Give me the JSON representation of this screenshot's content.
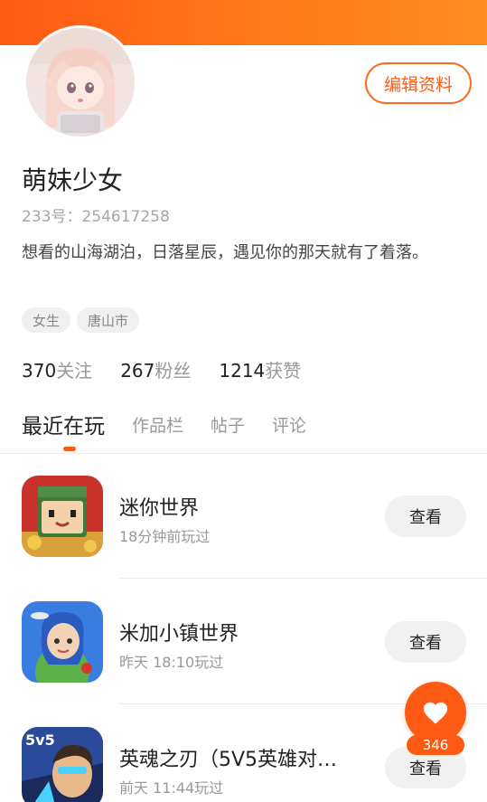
{
  "profile": {
    "nickname": "萌妹少女",
    "uid_text": "233号：254617258",
    "bio": "想看的山海湖泊，日落星辰，遇见你的那天就有了着落。",
    "tags": [
      "女生",
      "唐山市"
    ],
    "edit_label": "编辑资料",
    "avatar_icon": "anime-girl-avatar"
  },
  "stats": [
    {
      "num": "370",
      "label": "关注"
    },
    {
      "num": "267",
      "label": "粉丝"
    },
    {
      "num": "1214",
      "label": "获赞"
    }
  ],
  "tabs": [
    "最近在玩",
    "作品栏",
    "帖子",
    "评论"
  ],
  "active_tab": "最近在玩",
  "games": [
    {
      "name": "迷你世界",
      "time": "18分钟前玩过",
      "button": "查看",
      "icon": "mini-world-icon"
    },
    {
      "name": "米加小镇世界",
      "time": "昨天 18:10玩过",
      "button": "查看",
      "icon": "miga-town-icon"
    },
    {
      "name": "英魂之刃（5V5英雄对…",
      "time": "前天 11:44玩过",
      "button": "查看",
      "icon": "soul-blade-icon"
    }
  ],
  "like": {
    "count": "346",
    "icon": "heart-icon"
  },
  "colors": {
    "accent": "#ff5a14",
    "banner_end": "#ff8d22"
  }
}
